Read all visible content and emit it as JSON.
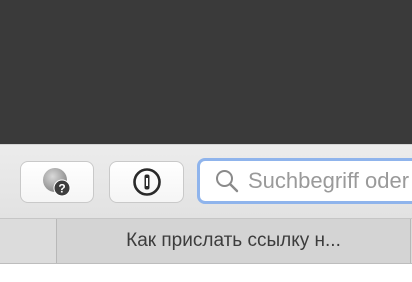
{
  "toolbar": {
    "help_button": {
      "icon": "help-extension-icon"
    },
    "password_button": {
      "icon": "1password-keyhole-icon"
    },
    "search": {
      "placeholder": "Suchbegriff oder Adresse eingeben",
      "value": "",
      "icon": "search-icon"
    }
  },
  "tabs": [
    {
      "label": "Как прислать ссылку н...",
      "active": true
    }
  ],
  "colors": {
    "top_area": "#3a3a3a",
    "toolbar_bg": "#e6e6e6",
    "search_focus_ring": "#8fb4ec",
    "tab_bar_bg": "#dcdcdc"
  }
}
